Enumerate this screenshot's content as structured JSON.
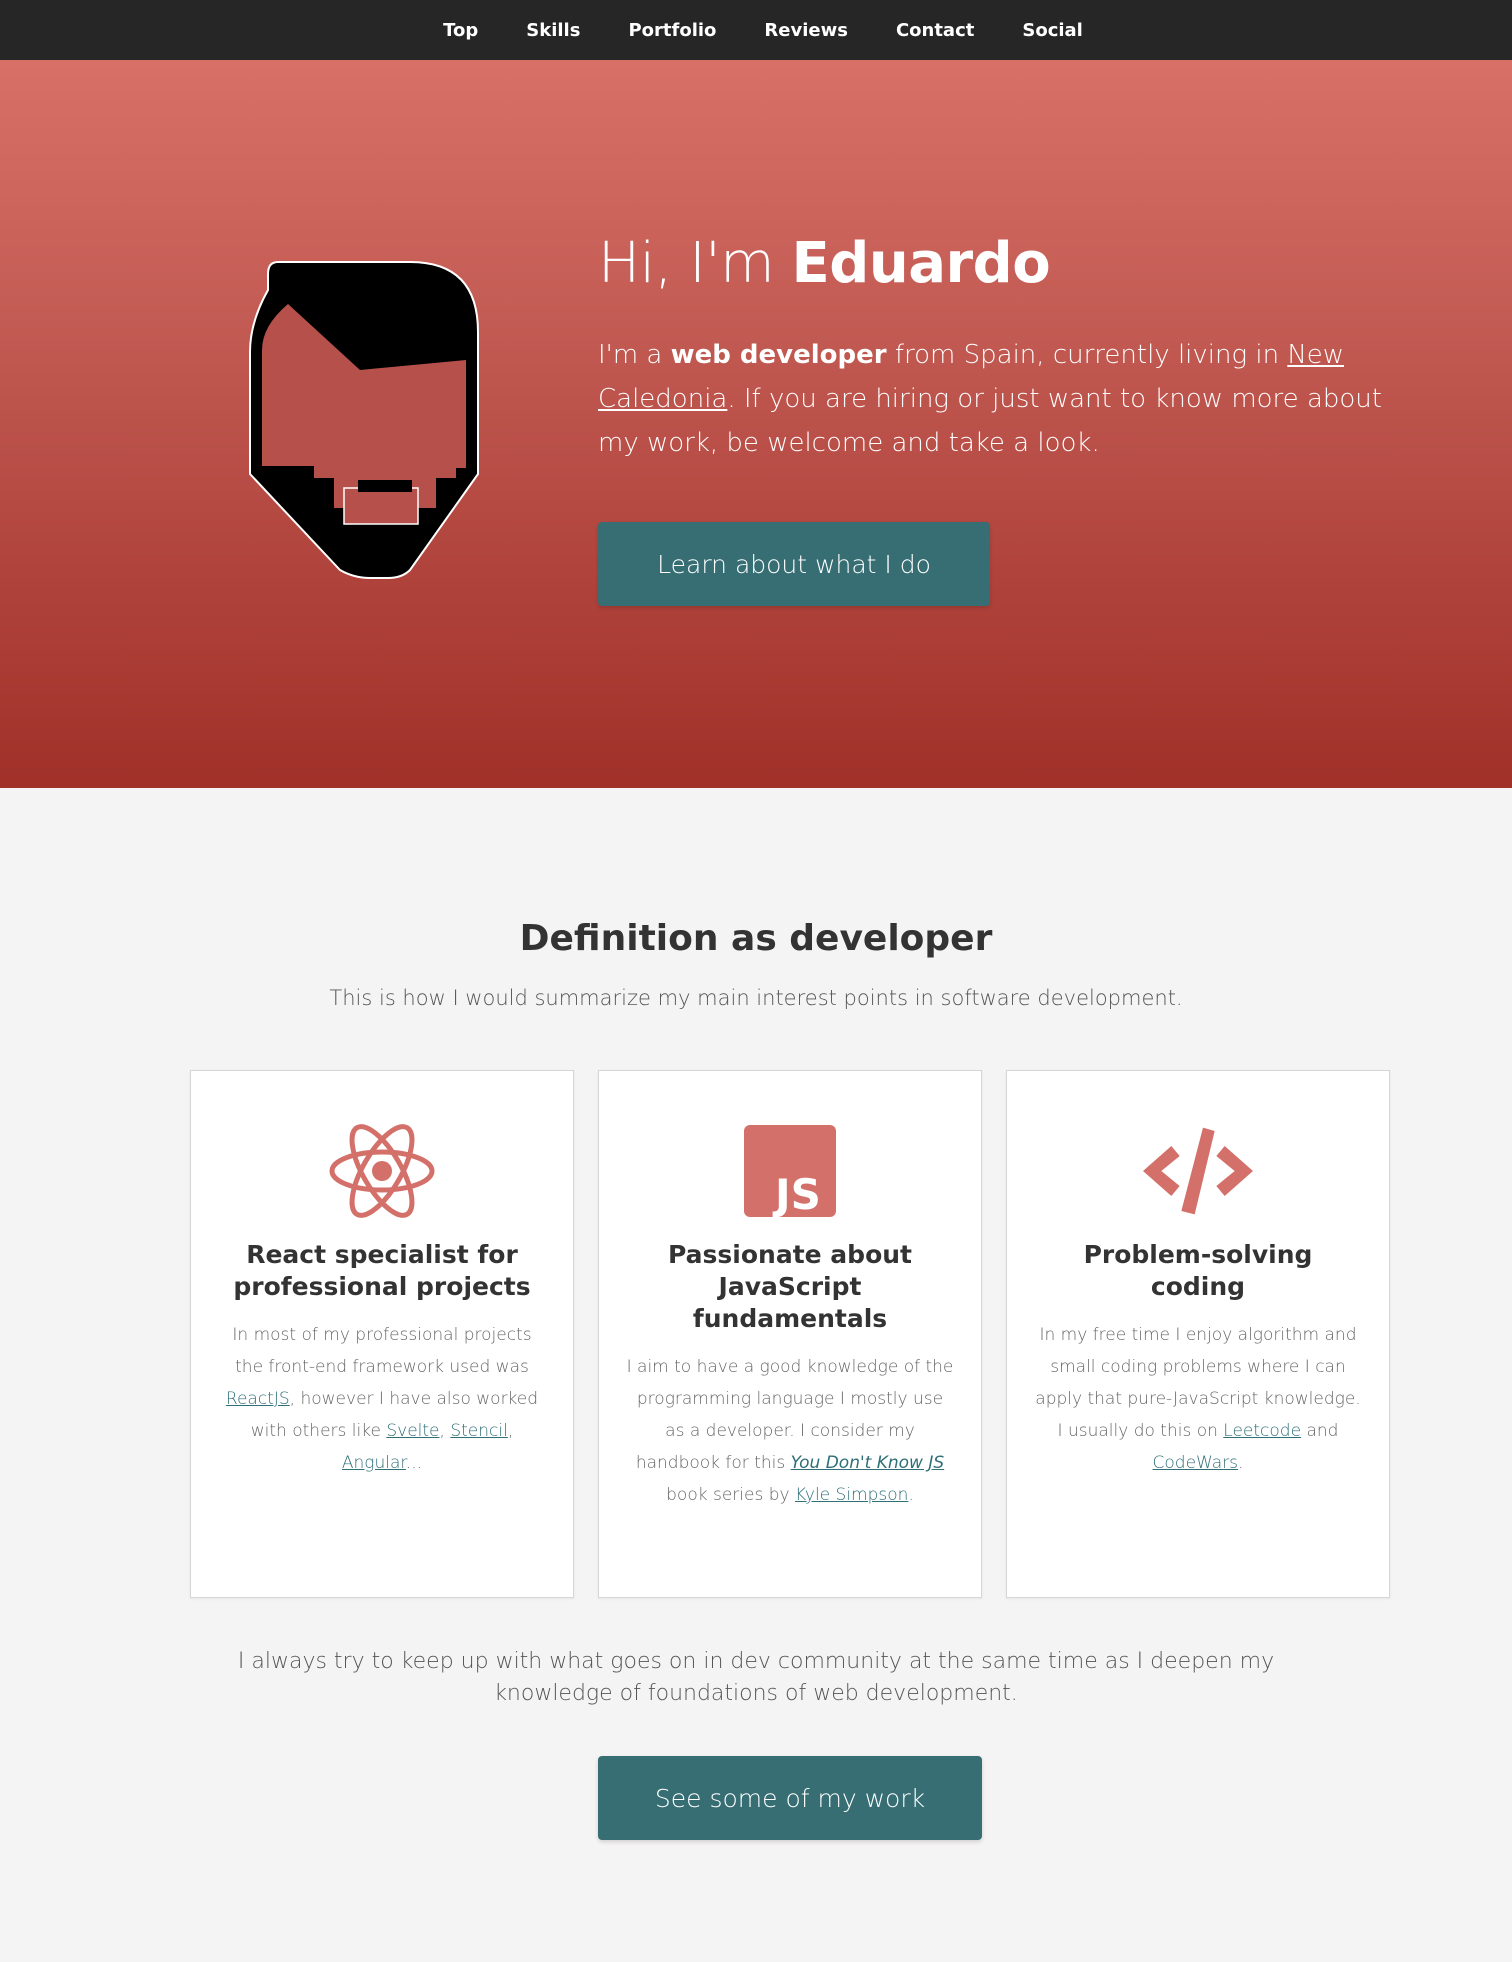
{
  "nav": {
    "items": [
      "Top",
      "Skills",
      "Portfolio",
      "Reviews",
      "Contact",
      "Social"
    ]
  },
  "hero": {
    "greeting": "Hi, I'm ",
    "name": "Eduardo",
    "desc_1": "I'm a ",
    "desc_role": "web developer",
    "desc_2": " from Spain, currently living in ",
    "desc_place": "New Caledonia",
    "desc_3": ". If you are hiring or just want to know more about my work, be welcome and take a look.",
    "button": "Learn about what I do",
    "colors": {
      "top": "#d97068",
      "bottom": "#a03028"
    }
  },
  "definition": {
    "title": "Definition as developer",
    "subtitle": "This is how I would summarize my main interest points in software development.",
    "cards": [
      {
        "icon": "react-icon",
        "title": "React specialist for professional projects",
        "t1": "In most of my professional projects the front-end framework used was ",
        "l1": "ReactJS",
        "t2": ", however I have also worked with others like ",
        "l2": "Svelte",
        "t3": ", ",
        "l3": "Stencil",
        "t4": ", ",
        "l4": "Angular",
        "t5": "..."
      },
      {
        "icon": "javascript-icon",
        "title": "Passionate about JavaScript fundamentals",
        "t1": "I aim to have a good knowledge of the programming language I mostly use as a developer. I consider my handbook for this ",
        "l1": "You Don't Know JS",
        "t2": " book series by ",
        "l2": "Kyle Simpson",
        "t3": "."
      },
      {
        "icon": "code-icon",
        "title": "Problem-solving coding",
        "t1": "In my free time I enjoy algorithm and small coding problems where I can apply that pure-JavaScript knowledge. I usually do this on ",
        "l1": "Leetcode",
        "t2": " and ",
        "l2": "CodeWars",
        "t3": "."
      }
    ],
    "closing": "I always try to keep up with what goes on in dev community at the same time as I deepen my knowledge of foundations of web development.",
    "button": "See some of my work"
  },
  "colors": {
    "accent": "#366e74",
    "icon": "#d4706a",
    "nav_bg": "#262626"
  }
}
